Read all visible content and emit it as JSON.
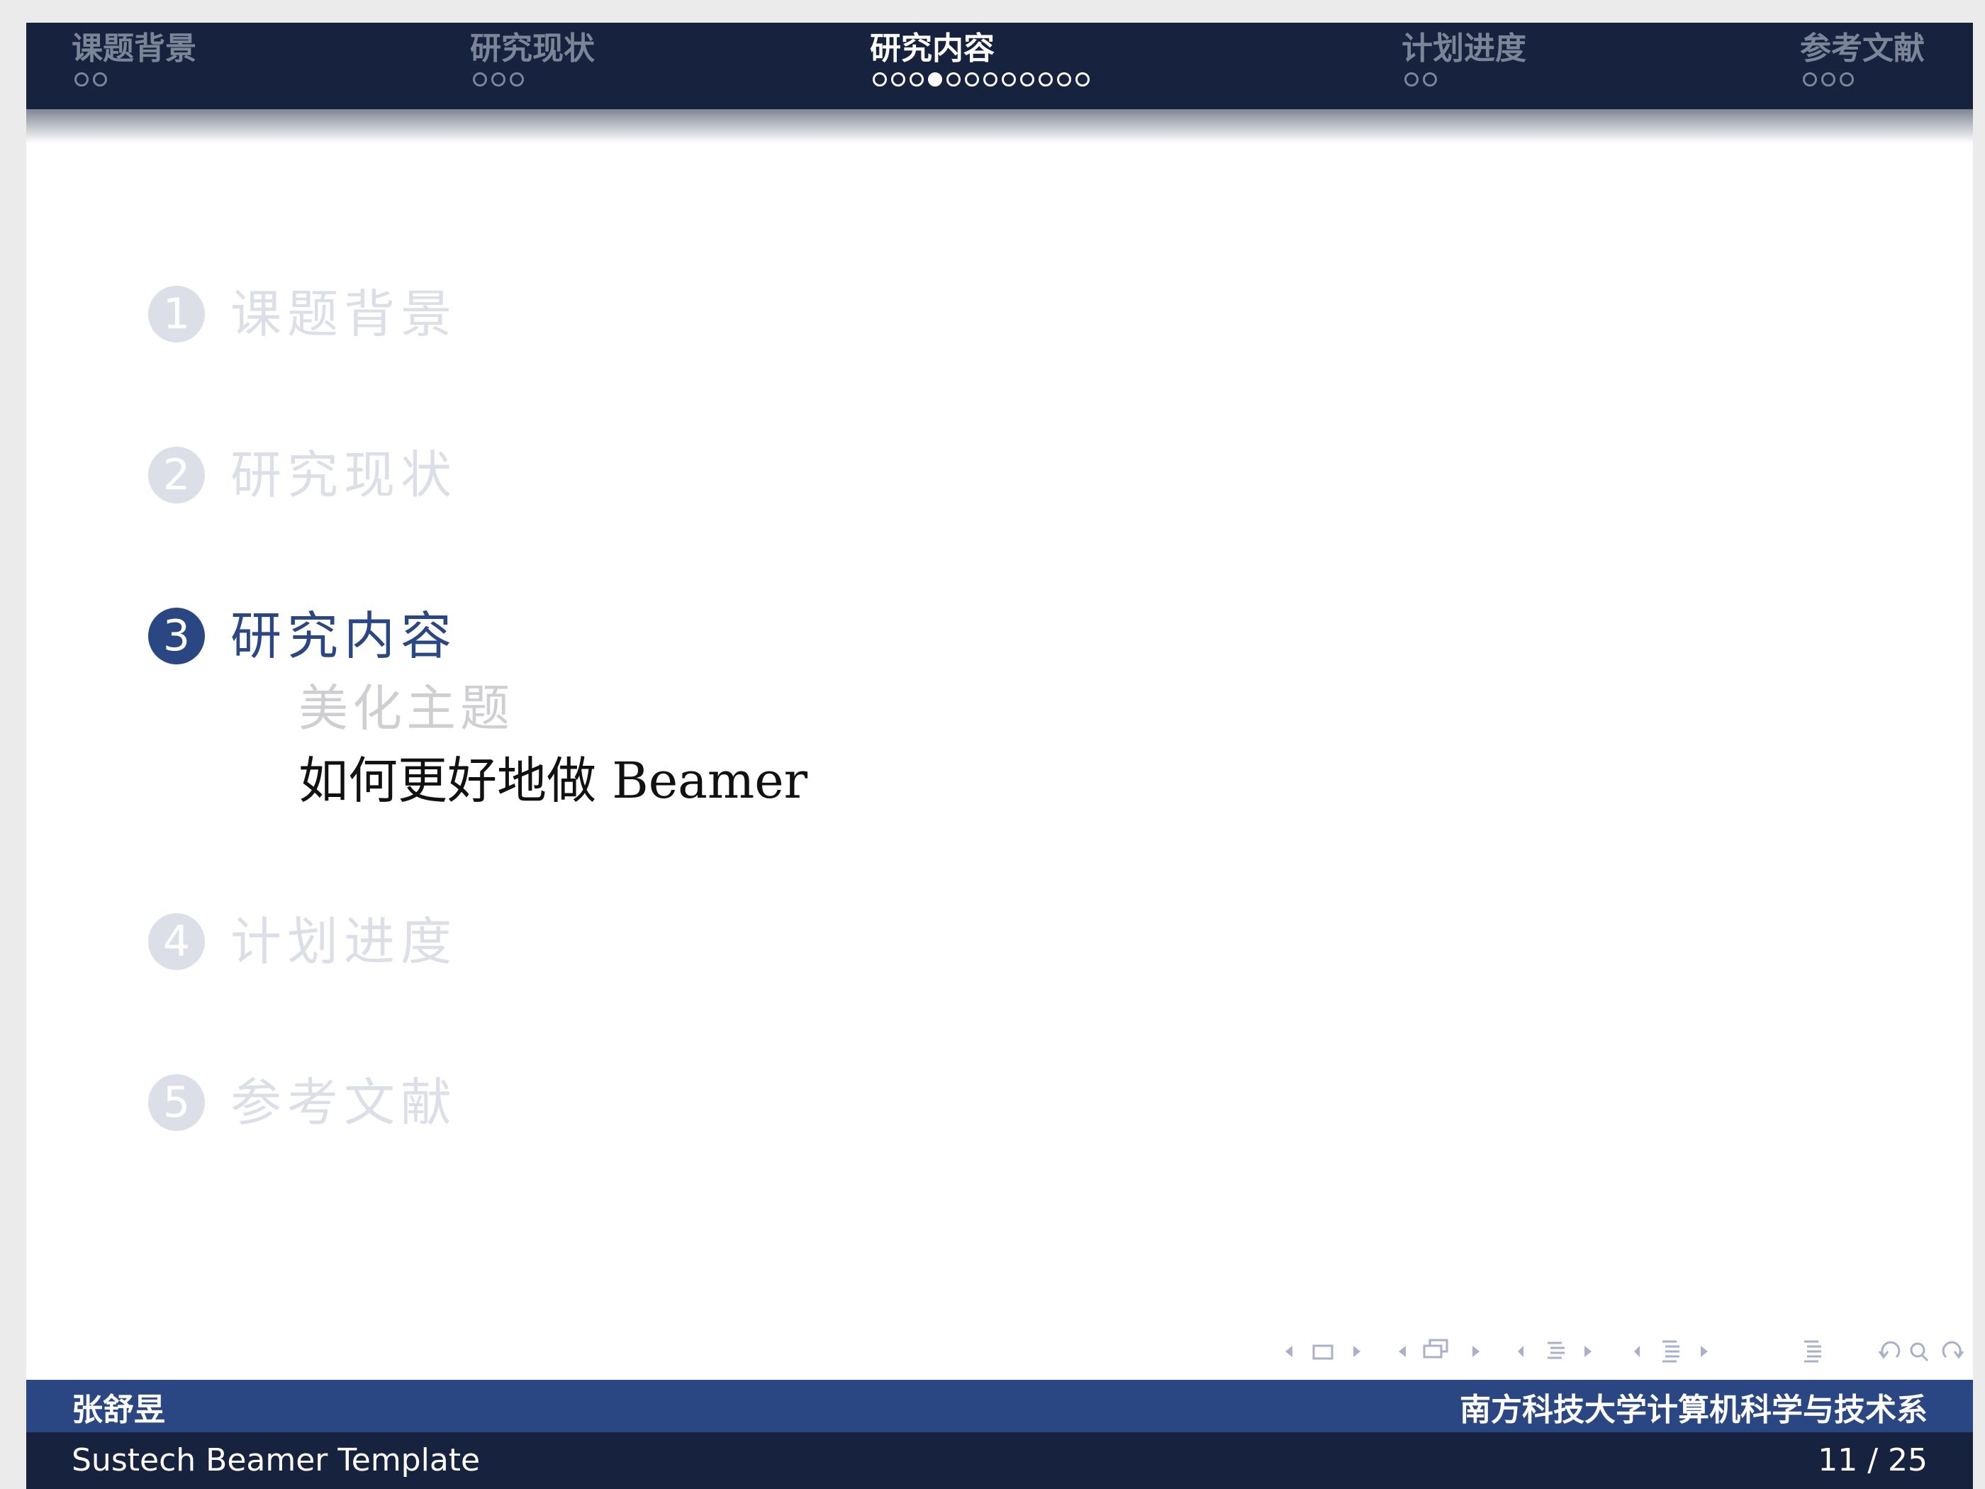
{
  "nav": {
    "sections": [
      {
        "title": "课题背景",
        "dots": 2,
        "current_dot": -1,
        "active": false
      },
      {
        "title": "研究现状",
        "dots": 3,
        "current_dot": -1,
        "active": false
      },
      {
        "title": "研究内容",
        "dots": 12,
        "current_dot": 3,
        "active": true
      },
      {
        "title": "计划进度",
        "dots": 2,
        "current_dot": -1,
        "active": false
      },
      {
        "title": "参考文献",
        "dots": 3,
        "current_dot": -1,
        "active": false
      }
    ]
  },
  "toc": {
    "items": [
      {
        "num": "1",
        "label": "课题背景"
      },
      {
        "num": "2",
        "label": "研究现状"
      },
      {
        "num": "3",
        "label": "研究内容"
      },
      {
        "num": "4",
        "label": "计划进度"
      },
      {
        "num": "5",
        "label": "参考文献"
      }
    ],
    "subitems": [
      {
        "label": "美化主题"
      },
      {
        "label": "如何更好地做 Beamer"
      }
    ]
  },
  "footer": {
    "author": "张舒昱",
    "institute": "南方科技大学计算机科学与技术系",
    "title": "Sustech Beamer Template",
    "page": "11 / 25"
  },
  "colors": {
    "nav_bg": "#17223f",
    "accent": "#2a4783",
    "dim": "#dcdfe8",
    "page_bg": "#ebebeb"
  },
  "icons": [
    "arrow-left-icon",
    "frame-icon",
    "arrow-right-icon",
    "subsection-icon",
    "section-icon",
    "document-icon",
    "undo-icon",
    "search-icon",
    "redo-icon"
  ]
}
